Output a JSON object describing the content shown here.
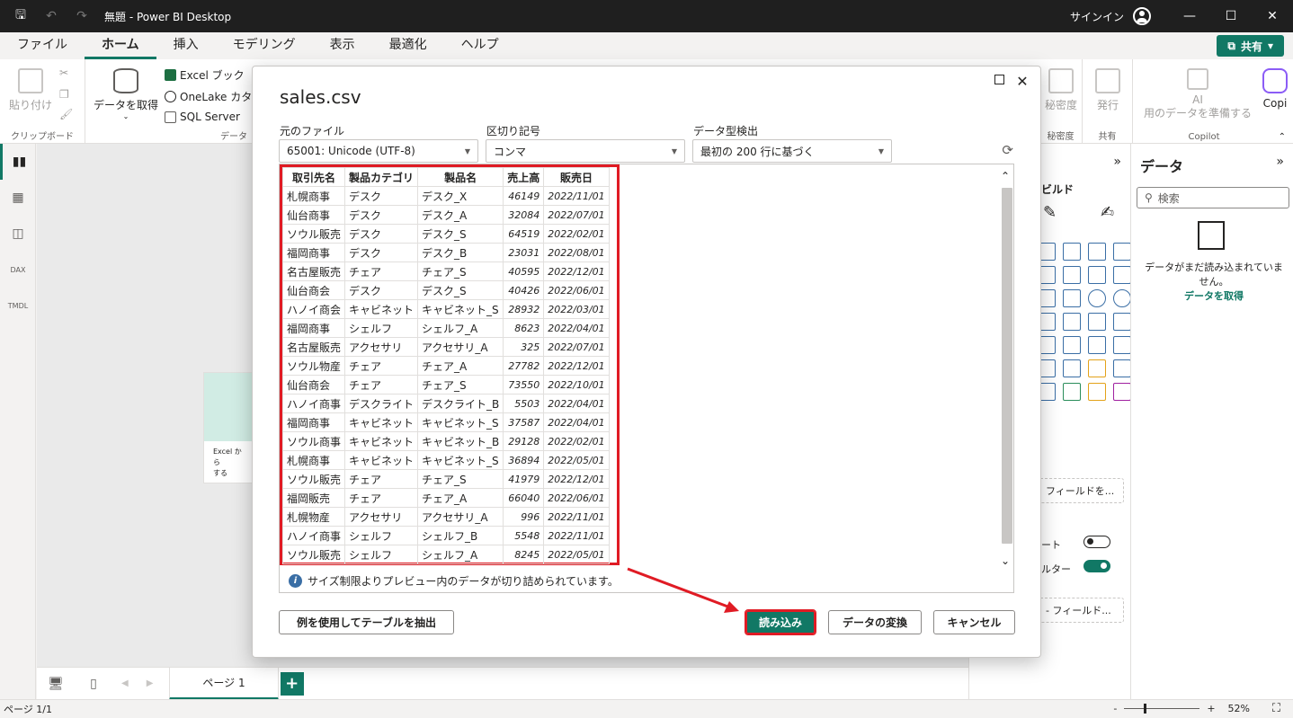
{
  "titlebar": {
    "title": "無題 - Power BI Desktop",
    "signin": "サインイン"
  },
  "menu": {
    "items": [
      "ファイル",
      "ホーム",
      "挿入",
      "モデリング",
      "表示",
      "最適化",
      "ヘルプ"
    ],
    "share": "共有"
  },
  "ribbon": {
    "paste": "貼り付け",
    "clipboard_group": "クリップボード",
    "get_data": "データを取得",
    "excel": "Excel ブック",
    "onelake": "OneLake カタロ",
    "sql": "SQL Server",
    "data_group": "データ",
    "sensitivity": "秘密度",
    "sensitivity_group": "秘密度",
    "publish": "発行",
    "share_group": "共有",
    "ai_label": "AI",
    "ai_prepare": "用のデータを準備する",
    "copilot": "Copi",
    "copilot_group": "Copilot"
  },
  "canvas": {
    "card_text": "Excel から\nする"
  },
  "pages": {
    "tab": "ページ 1",
    "add": "+"
  },
  "status": {
    "page": "ページ 1/1",
    "zoom": "52%",
    "minus": "-",
    "plus": "+"
  },
  "viz": {
    "build": "ビルド",
    "add_field_1": "フィールドを...",
    "toggle1_label": "ート",
    "toggle2_label": "ルター",
    "add_field_2": "- フィールド..."
  },
  "datapane": {
    "title": "データ",
    "search_placeholder": "検索",
    "message": "データがまだ読み込まれていません。",
    "get_data": "データを取得"
  },
  "dialog": {
    "title": "sales.csv",
    "file_origin_label": "元のファイル",
    "file_origin_value": "65001: Unicode (UTF-8)",
    "delimiter_label": "区切り記号",
    "delimiter_value": "コンマ",
    "detect_label": "データ型検出",
    "detect_value": "最初の 200 行に基づく",
    "notice": "サイズ制限よりプレビュー内のデータが切り詰められています。",
    "extract_button": "例を使用してテーブルを抽出",
    "load_button": "読み込み",
    "transform_button": "データの変換",
    "cancel_button": "キャンセル"
  },
  "table": {
    "headers": [
      "取引先名",
      "製品カテゴリ",
      "製品名",
      "売上高",
      "販売日"
    ],
    "rows": [
      [
        "札幌商事",
        "デスク",
        "デスク_X",
        "46149",
        "2022/11/01"
      ],
      [
        "仙台商事",
        "デスク",
        "デスク_A",
        "32084",
        "2022/07/01"
      ],
      [
        "ソウル販売",
        "デスク",
        "デスク_S",
        "64519",
        "2022/02/01"
      ],
      [
        "福岡商事",
        "デスク",
        "デスク_B",
        "23031",
        "2022/08/01"
      ],
      [
        "名古屋販売",
        "チェア",
        "チェア_S",
        "40595",
        "2022/12/01"
      ],
      [
        "仙台商会",
        "デスク",
        "デスク_S",
        "40426",
        "2022/06/01"
      ],
      [
        "ハノイ商会",
        "キャビネット",
        "キャビネット_S",
        "28932",
        "2022/03/01"
      ],
      [
        "福岡商事",
        "シェルフ",
        "シェルフ_A",
        "8623",
        "2022/04/01"
      ],
      [
        "名古屋販売",
        "アクセサリ",
        "アクセサリ_A",
        "325",
        "2022/07/01"
      ],
      [
        "ソウル物産",
        "チェア",
        "チェア_A",
        "27782",
        "2022/12/01"
      ],
      [
        "仙台商会",
        "チェア",
        "チェア_S",
        "73550",
        "2022/10/01"
      ],
      [
        "ハノイ商事",
        "デスクライト",
        "デスクライト_B",
        "5503",
        "2022/04/01"
      ],
      [
        "福岡商事",
        "キャビネット",
        "キャビネット_S",
        "37587",
        "2022/04/01"
      ],
      [
        "ソウル商事",
        "キャビネット",
        "キャビネット_B",
        "29128",
        "2022/02/01"
      ],
      [
        "札幌商事",
        "キャビネット",
        "キャビネット_S",
        "36894",
        "2022/05/01"
      ],
      [
        "ソウル販売",
        "チェア",
        "チェア_S",
        "41979",
        "2022/12/01"
      ],
      [
        "福岡販売",
        "チェア",
        "チェア_A",
        "66040",
        "2022/06/01"
      ],
      [
        "札幌物産",
        "アクセサリ",
        "アクセサリ_A",
        "996",
        "2022/11/01"
      ],
      [
        "ハノイ商事",
        "シェルフ",
        "シェルフ_B",
        "5548",
        "2022/11/01"
      ],
      [
        "ソウル販売",
        "シェルフ",
        "シェルフ_A",
        "8245",
        "2022/05/01"
      ]
    ]
  },
  "colors": {
    "accent": "#117865",
    "highlight": "#e01b24",
    "titlebar": "#1f1f1f"
  }
}
